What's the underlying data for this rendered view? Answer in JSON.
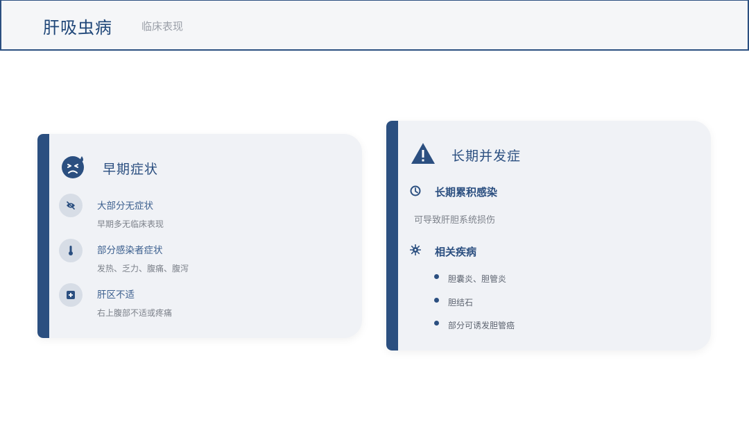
{
  "header": {
    "title": "肝吸虫病",
    "subtitle": "临床表现"
  },
  "early": {
    "title": "早期症状",
    "icon": "sick-face-icon",
    "items": [
      {
        "icon": "eye-slash-icon",
        "title": "大部分无症状",
        "desc": "早期多无临床表现"
      },
      {
        "icon": "thermometer-icon",
        "title": "部分感染者症状",
        "desc": "发热、乏力、腹痛、腹泻"
      },
      {
        "icon": "medical-plus-icon",
        "title": "肝区不适",
        "desc": "右上腹部不适或疼痛"
      }
    ]
  },
  "longterm": {
    "title": "长期并发症",
    "icon": "warning-triangle-icon",
    "chronic": {
      "icon": "clock-icon",
      "title": "长期累积感染",
      "desc": "可导致肝胆系统损伤"
    },
    "related": {
      "icon": "virus-icon",
      "title": "相关疾病",
      "items": [
        "胆囊炎、胆管炎",
        "胆结石",
        "部分可诱发胆管癌"
      ]
    }
  },
  "colors": {
    "primary": "#2b4f80",
    "card_bg": "#f0f2f6",
    "header_bg": "#f5f6f8"
  }
}
